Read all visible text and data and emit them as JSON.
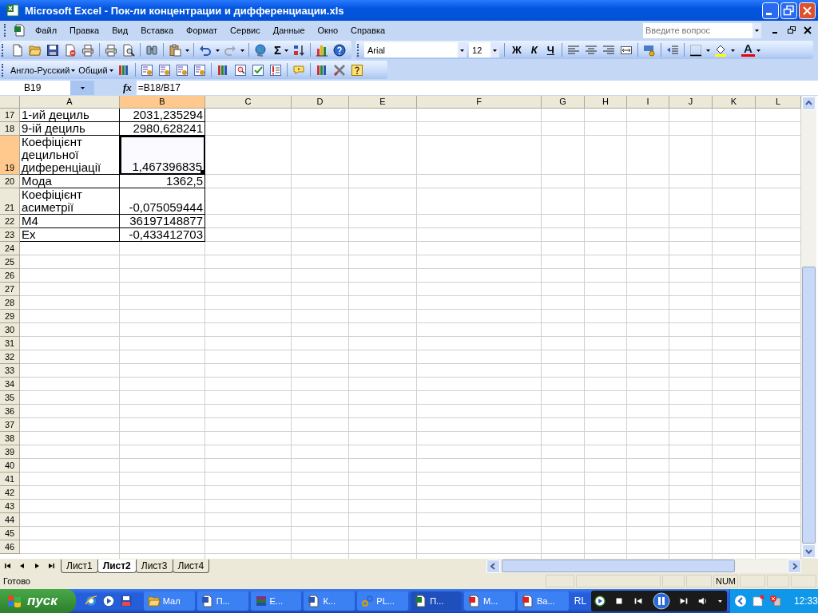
{
  "window": {
    "title": "Microsoft Excel - Пок-ли концентрации и дифференциации.xls"
  },
  "menu": {
    "items": [
      {
        "label": "Файл"
      },
      {
        "label": "Правка"
      },
      {
        "label": "Вид"
      },
      {
        "label": "Вставка"
      },
      {
        "label": "Формат"
      },
      {
        "label": "Сервис"
      },
      {
        "label": "Данные"
      },
      {
        "label": "Окно"
      },
      {
        "label": "Справка"
      }
    ],
    "help_search": {
      "placeholder": "Введите вопрос"
    }
  },
  "standard_toolbar": {
    "autosum": "Σ"
  },
  "formatting_toolbar": {
    "font": "Arial",
    "size": "12",
    "bold": "Ж",
    "italic": "К",
    "underline": "Ч",
    "font_color": "A"
  },
  "dictionary_toolbar": {
    "language": "Англо-Русский",
    "mode": "Общий"
  },
  "formula_bar": {
    "name_box": "B19",
    "function_label": "fx",
    "formula": "=B18/B17"
  },
  "sheet": {
    "columns": [
      {
        "label": "A",
        "selected": false
      },
      {
        "label": "B",
        "selected": true
      },
      {
        "label": "C",
        "selected": false
      },
      {
        "label": "D",
        "selected": false
      },
      {
        "label": "E",
        "selected": false
      },
      {
        "label": "F",
        "selected": false
      },
      {
        "label": "G",
        "selected": false
      },
      {
        "label": "H",
        "selected": false
      },
      {
        "label": "I",
        "selected": false
      },
      {
        "label": "J",
        "selected": false
      },
      {
        "label": "K",
        "selected": false
      },
      {
        "label": "L",
        "selected": false
      }
    ],
    "rows": [
      {
        "number": "17",
        "selected": false,
        "cells": [
          {
            "text": "1-ий дециль",
            "selected": false
          },
          {
            "text": "2031,235294",
            "selected": false
          }
        ]
      },
      {
        "number": "18",
        "selected": false,
        "cells": [
          {
            "text": "9-ій дециль",
            "selected": false
          },
          {
            "text": "2980,628241",
            "selected": false
          }
        ]
      },
      {
        "number": "19",
        "selected": true,
        "cells": [
          {
            "text": "Коефіцієнт децильної диференціації",
            "selected": false
          },
          {
            "text": "1,467396835",
            "selected": true
          }
        ]
      },
      {
        "number": "20",
        "selected": false,
        "cells": [
          {
            "text": "Мода",
            "selected": false
          },
          {
            "text": "1362,5",
            "selected": false
          }
        ]
      },
      {
        "number": "21",
        "selected": false,
        "cells": [
          {
            "text": "Коефіцієнт асиметрії",
            "selected": false
          },
          {
            "text": "-0,075059444",
            "selected": false
          }
        ]
      },
      {
        "number": "22",
        "selected": false,
        "cells": [
          {
            "text": "M4",
            "selected": false
          },
          {
            "text": "36197148877",
            "selected": false
          }
        ]
      },
      {
        "number": "23",
        "selected": false,
        "cells": [
          {
            "text": "Ex",
            "selected": false
          },
          {
            "text": "-0,433412703",
            "selected": false
          }
        ]
      },
      {
        "number": "24",
        "selected": false
      },
      {
        "number": "25",
        "selected": false
      },
      {
        "number": "26",
        "selected": false
      },
      {
        "number": "27",
        "selected": false
      },
      {
        "number": "28",
        "selected": false
      },
      {
        "number": "29",
        "selected": false
      },
      {
        "number": "30",
        "selected": false
      },
      {
        "number": "31",
        "selected": false
      },
      {
        "number": "32",
        "selected": false
      },
      {
        "number": "33",
        "selected": false
      },
      {
        "number": "34",
        "selected": false
      },
      {
        "number": "35",
        "selected": false
      },
      {
        "number": "36",
        "selected": false
      },
      {
        "number": "37",
        "selected": false
      },
      {
        "number": "38",
        "selected": false
      },
      {
        "number": "39",
        "selected": false
      },
      {
        "number": "40",
        "selected": false
      },
      {
        "number": "41",
        "selected": false
      },
      {
        "number": "42",
        "selected": false
      },
      {
        "number": "43",
        "selected": false
      },
      {
        "number": "44",
        "selected": false
      },
      {
        "number": "45",
        "selected": false
      },
      {
        "number": "46",
        "selected": false
      }
    ]
  },
  "sheet_tabs": [
    {
      "label": "Лист1",
      "selected": false
    },
    {
      "label": "Лист2",
      "selected": true
    },
    {
      "label": "Лист3",
      "selected": false
    },
    {
      "label": "Лист4",
      "selected": false
    }
  ],
  "status_bar": {
    "text": "Готово",
    "indicator": "NUM"
  },
  "taskbar": {
    "start": "пуск",
    "tasks": [
      {
        "label": "Мал",
        "kind": "folder",
        "selected": false
      },
      {
        "label": "П...",
        "kind": "word",
        "selected": false
      },
      {
        "label": "E...",
        "kind": "archive",
        "selected": false
      },
      {
        "label": "К...",
        "kind": "word",
        "selected": false
      },
      {
        "label": "PL...",
        "kind": "link",
        "selected": false
      },
      {
        "label": "П...",
        "kind": "excel",
        "selected": true
      },
      {
        "label": "М...",
        "kind": "pdf",
        "selected": false
      },
      {
        "label": "Ва...",
        "kind": "pdf",
        "selected": false
      }
    ],
    "language": "RL",
    "clock": "12:33"
  }
}
